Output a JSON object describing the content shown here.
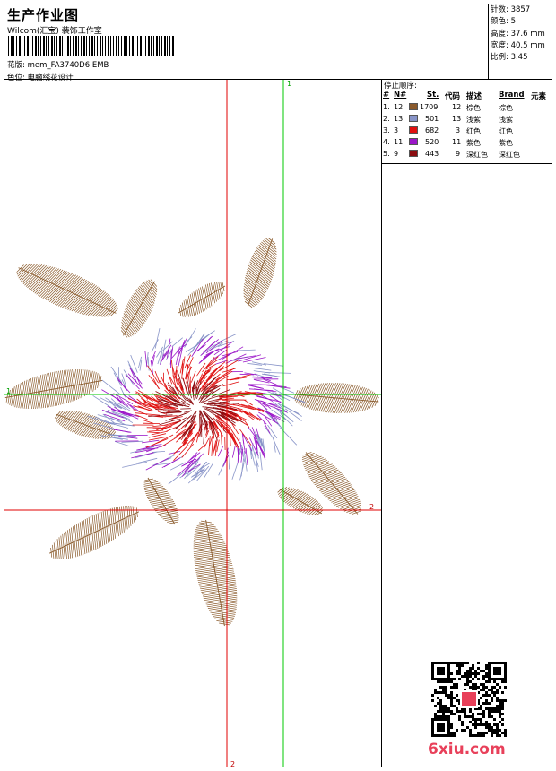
{
  "header": {
    "title": "生产作业图",
    "company": "Wilcom(汇宝) 装饰工作室",
    "pattern_label": "花版:",
    "pattern_value": "mem_FA3740D6.EMB",
    "color_label": "色位:",
    "color_value": "电脑绣花设计"
  },
  "stats": {
    "stitches": "针数: 3857",
    "colors": "颜色: 5",
    "height": "高度: 37.6 mm",
    "width": "宽度: 40.5 mm",
    "scale": "比例: 3.45"
  },
  "stop_sequence": {
    "title": "停止顺序:",
    "headers": [
      "#",
      "N#",
      "St.",
      "代码",
      "描述",
      "Brand",
      "元素"
    ],
    "rows": [
      {
        "num": "1.",
        "n": "12",
        "color": "#8a5a2b",
        "st": "1709",
        "code": "12",
        "desc": "棕色",
        "brand": "棕色"
      },
      {
        "num": "2.",
        "n": "13",
        "color": "#8894c8",
        "st": "501",
        "code": "13",
        "desc": "浅紫",
        "brand": "浅紫"
      },
      {
        "num": "3.",
        "n": "3",
        "color": "#e01010",
        "st": "682",
        "code": "3",
        "desc": "红色",
        "brand": "红色"
      },
      {
        "num": "4.",
        "n": "11",
        "color": "#9b16c8",
        "st": "520",
        "code": "11",
        "desc": "紫色",
        "brand": "紫色"
      },
      {
        "num": "5.",
        "n": "9",
        "color": "#8b0c10",
        "st": "443",
        "code": "9",
        "desc": "深红色",
        "brand": "深红色"
      }
    ]
  },
  "guides": {
    "green_v_label": "1",
    "green_h_label": "1",
    "red_h_label": "2",
    "red_v_label": "2"
  },
  "palette": {
    "brown": "#8a5a2b",
    "lilac": "#8894c8",
    "red": "#e01010",
    "purple": "#9b16c8",
    "dark_red": "#8b0c10",
    "guide_green": "#00c800",
    "guide_red": "#e00000"
  },
  "watermark": "6xiu.com"
}
